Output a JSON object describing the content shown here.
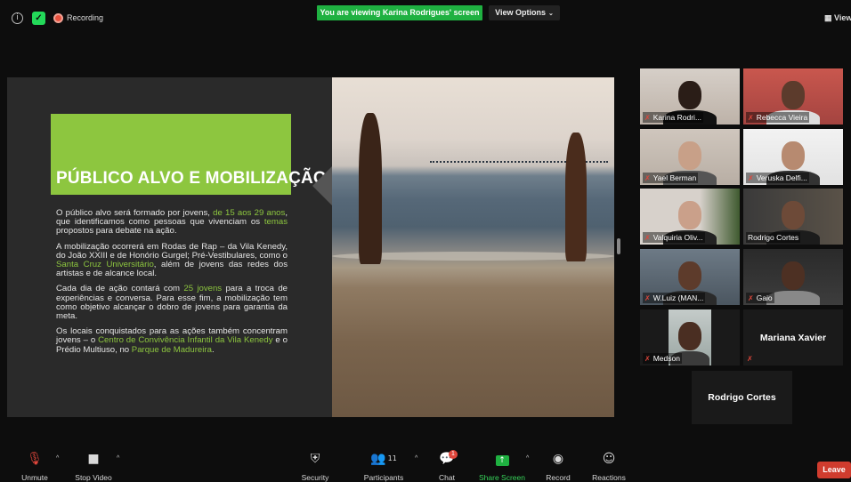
{
  "topbar": {
    "recording_label": "Recording",
    "viewing_banner": "You are viewing Karina Rodrigues' screen",
    "view_options": "View Options",
    "view_label": "View"
  },
  "slide": {
    "title": "PÚBLICO ALVO E MOBILIZAÇÃO",
    "p1": {
      "a": "O público alvo será formado por jovens, ",
      "b": "de 15 aos 29 anos",
      "c": ", que identificamos como pessoas que vivenciam os ",
      "d": "temas",
      "e": " propostos para debate na ação."
    },
    "p2": {
      "a": "A mobilização ocorrerá em Rodas de Rap – da Vila Kenedy, do João XXIII e de Honório Gurgel; Pré-Vestibulares, como o ",
      "b": "Santa Cruz Universitário",
      "c": ", além de jovens das redes dos artistas e de alcance local."
    },
    "p3": {
      "a": "Cada dia de ação contará com ",
      "b": "25 jovens",
      "c": " para a troca de experiências e conversa. Para esse fim, a mobilização tem como objetivo alcançar o dobro de jovens para garantia da meta."
    },
    "p4": {
      "a": "Os locais conquistados para as ações também concentram jovens – o ",
      "b": "Centro de Convivência Infantil da Vila Kenedy",
      "c": " e o Prédio Multiuso, no ",
      "d": "Parque de Madureira",
      "e": "."
    }
  },
  "participants": [
    {
      "name": "Karina Rodri...",
      "muted": true
    },
    {
      "name": "Rebecca Vieira",
      "muted": true
    },
    {
      "name": "Yael Berman",
      "muted": true
    },
    {
      "name": "Veruska Delfi...",
      "muted": true
    },
    {
      "name": "Valquiria Oliv...",
      "muted": true
    },
    {
      "name": "Rodrigo Cortes",
      "muted": false,
      "active": true
    },
    {
      "name": "W.Luiz (MAN...",
      "muted": true
    },
    {
      "name": "Gaio",
      "muted": true
    },
    {
      "name": "Medson",
      "muted": true
    },
    {
      "name": "Mariana Xavier",
      "muted": true,
      "video_off": true
    }
  ],
  "pinned_name": "Rodrigo Cortes",
  "toolbar": {
    "unmute": "Unmute",
    "stop_video": "Stop Video",
    "security": "Security",
    "participants": "Participants",
    "participants_count": "11",
    "chat": "Chat",
    "chat_badge": "1",
    "share_screen": "Share Screen",
    "record": "Record",
    "reactions": "Reactions",
    "leave": "Leave"
  },
  "colors": {
    "accent_green": "#8dc63f",
    "share_green": "#1fb141",
    "mute_red": "#e0463b",
    "active_outline": "#c7e26b"
  }
}
